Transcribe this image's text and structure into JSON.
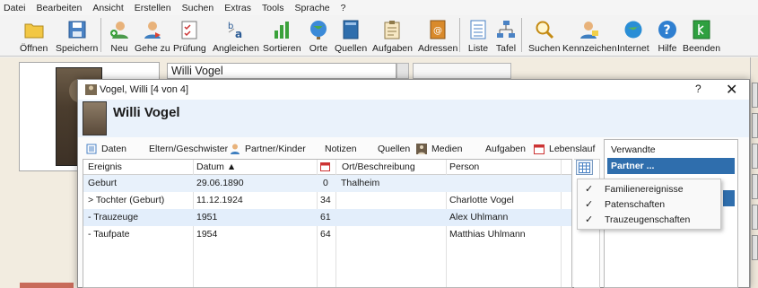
{
  "menubar": [
    "Datei",
    "Bearbeiten",
    "Ansicht",
    "Erstellen",
    "Suchen",
    "Extras",
    "Tools",
    "Sprache",
    "?"
  ],
  "toolbar": {
    "buttons": [
      {
        "label": "Öffnen",
        "icon": "folder-icon"
      },
      {
        "label": "Speichern",
        "icon": "save-icon"
      },
      {
        "label": "Neu",
        "icon": "new-person-icon"
      },
      {
        "label": "Gehe zu",
        "icon": "goto-person-icon"
      },
      {
        "label": "Prüfung",
        "icon": "check-icon"
      },
      {
        "label": "Angleichen",
        "icon": "align-icon"
      },
      {
        "label": "Sortieren",
        "icon": "sort-icon"
      },
      {
        "label": "Orte",
        "icon": "globe-icon"
      },
      {
        "label": "Quellen",
        "icon": "book-icon"
      },
      {
        "label": "Aufgaben",
        "icon": "tasks-icon"
      },
      {
        "label": "Adressen",
        "icon": "addressbook-icon"
      },
      {
        "label": "Liste",
        "icon": "list-icon"
      },
      {
        "label": "Tafel",
        "icon": "tree-icon"
      },
      {
        "label": "Suchen",
        "icon": "search-icon"
      },
      {
        "label": "Kennzeichen",
        "icon": "tag-person-icon"
      },
      {
        "label": "Internet",
        "icon": "internet-icon"
      },
      {
        "label": "Hilfe",
        "icon": "help-icon"
      },
      {
        "label": "Beenden",
        "icon": "exit-icon"
      }
    ]
  },
  "background": {
    "person_name": "Willi Vogel"
  },
  "dialog": {
    "title": "Vogel, Willi [4 von 4]",
    "help_label": "?",
    "close_label": "✕",
    "person_name": "Willi Vogel",
    "tabs": [
      "Daten",
      "Eltern/Geschwister",
      "Partner/Kinder",
      "Notizen",
      "Quellen",
      "Medien",
      "Aufgaben",
      "Lebenslauf"
    ],
    "grid": {
      "columns": [
        "Ereignis",
        "Datum ▲",
        "",
        "Ort/Beschreibung",
        "Person"
      ],
      "rows": [
        {
          "event": "Geburt",
          "date": "29.06.1890",
          "age": "0",
          "place": "Thalheim",
          "person": ""
        },
        {
          "event": "> Tochter (Geburt)",
          "date": "11.12.1924",
          "age": "34",
          "place": "",
          "person": "Charlotte Vogel"
        },
        {
          "event": "- Trauzeuge",
          "date": "1951",
          "age": "61",
          "place": "",
          "person": "Alex Uhlmann"
        },
        {
          "event": "- Taufpate",
          "date": "1954",
          "age": "64",
          "place": "",
          "person": "Matthias Uhlmann"
        }
      ]
    },
    "right_panel": {
      "items": [
        "Verwandte",
        "Partner ..."
      ]
    },
    "context_menu": {
      "items": [
        {
          "label": "Familienereignisse",
          "checked": "✓"
        },
        {
          "label": "Patenschaften",
          "checked": "✓"
        },
        {
          "label": "Trauzeugenschaften",
          "checked": "✓"
        }
      ]
    }
  },
  "colors": {
    "accent": "#2f6ead",
    "header_bg": "#eaf2fb",
    "row_alt": "#e3eefb",
    "window_bg": "#f2ece0"
  }
}
